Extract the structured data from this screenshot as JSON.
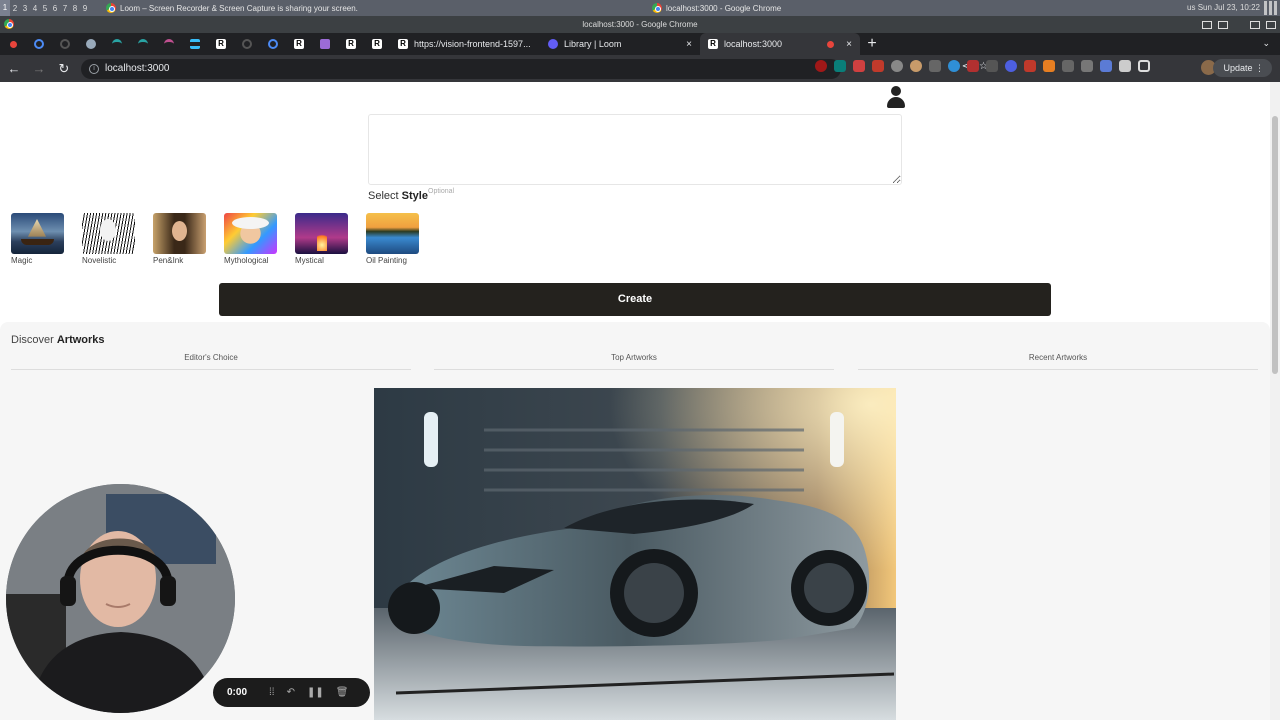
{
  "os": {
    "workspaces": [
      "1",
      "2",
      "3",
      "4",
      "5",
      "6",
      "7",
      "8",
      "9"
    ],
    "window1_title": "Loom – Screen Recorder & Screen Capture is sharing your screen.",
    "window2_title": "localhost:3000 - Google Chrome",
    "tray_text": "us  Sun Jul 23, 10:22"
  },
  "browser": {
    "window_title": "localhost:3000 - Google Chrome",
    "tabs": [
      {
        "label": "https://vision-frontend-1597..."
      },
      {
        "label": "Library | Loom"
      },
      {
        "label": "localhost:3000"
      }
    ],
    "url": "localhost:3000",
    "update_label": "Update",
    "close_glyph": "×",
    "newtab_glyph": "+"
  },
  "app": {
    "select_label": "Select",
    "style_label": "Style",
    "optional_label": "Optional",
    "styles": [
      {
        "label": "Magic"
      },
      {
        "label": "Novelistic"
      },
      {
        "label": "Pen&Ink"
      },
      {
        "label": "Mythological"
      },
      {
        "label": "Mystical"
      },
      {
        "label": "Oil Painting"
      }
    ],
    "create_label": "Create",
    "discover_label": "Discover",
    "artworks_label": "Artworks",
    "discover_tabs": [
      "Editor's Choice",
      "Top Artworks",
      "Recent Artworks"
    ]
  },
  "loom": {
    "timer": "0:00"
  },
  "colors": {
    "create_button": "#24221e",
    "browser_dark": "#202124",
    "toolbar": "#35363a"
  }
}
